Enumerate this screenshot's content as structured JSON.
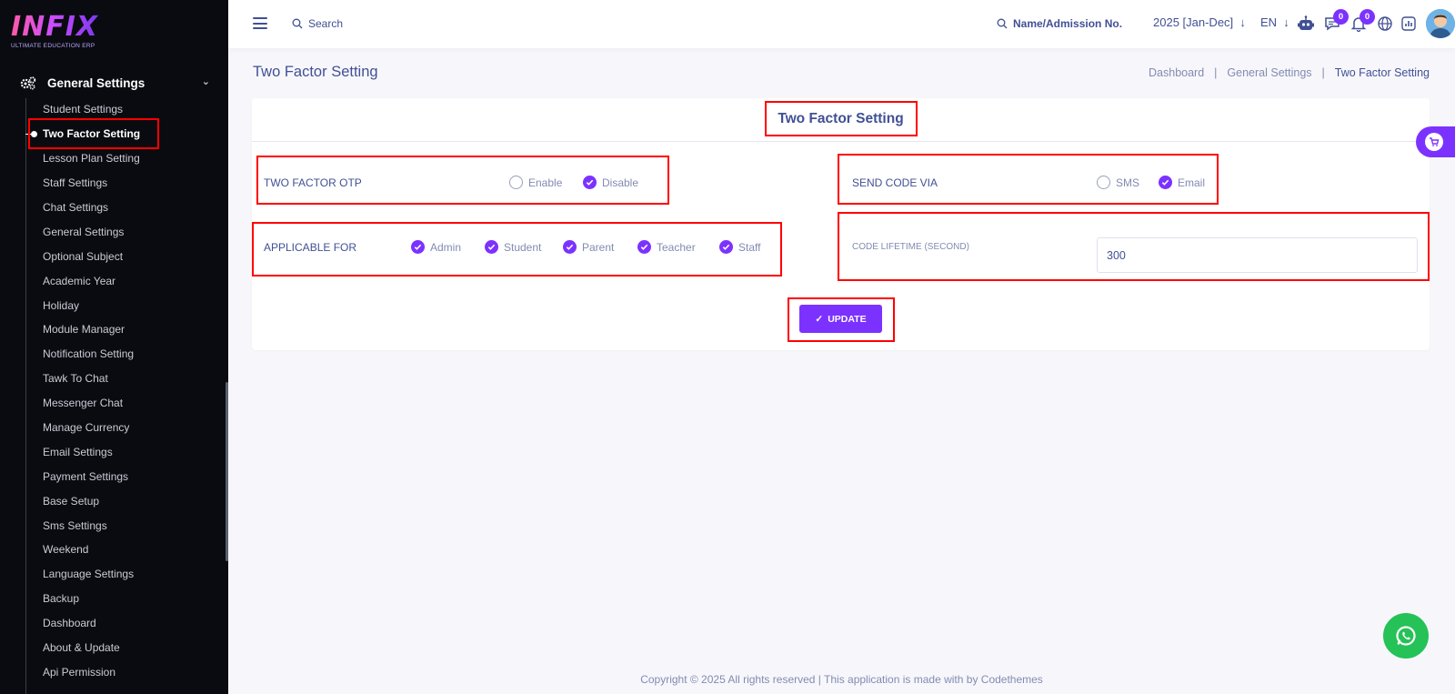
{
  "brand": {
    "logo": "INFIX",
    "tagline": "ULTIMATE EDUCATION ERP"
  },
  "sidebar": {
    "section": "General Settings",
    "items": [
      "Student Settings",
      "Two Factor Setting",
      "Lesson Plan Setting",
      "Staff Settings",
      "Chat Settings",
      "General Settings",
      "Optional Subject",
      "Academic Year",
      "Holiday",
      "Module Manager",
      "Notification Setting",
      "Tawk To Chat",
      "Messenger Chat",
      "Manage Currency",
      "Email Settings",
      "Payment Settings",
      "Base Setup",
      "Sms Settings",
      "Weekend",
      "Language Settings",
      "Backup",
      "Dashboard",
      "About & Update",
      "Api Permission"
    ],
    "active_index": 1
  },
  "header": {
    "search_label": "Search",
    "search_student_label": "Name/Admission No.",
    "academic_year": "2025 [Jan-Dec]",
    "language": "EN",
    "chat_badge": "0",
    "notification_badge": "0"
  },
  "page": {
    "title": "Two Factor Setting",
    "breadcrumb": [
      "Dashboard",
      "General Settings",
      "Two Factor Setting"
    ],
    "breadcrumb_separator": "|"
  },
  "form": {
    "title": "Two Factor Setting",
    "otp": {
      "label": "TWO FACTOR OTP",
      "options": [
        {
          "label": "Enable",
          "checked": false
        },
        {
          "label": "Disable",
          "checked": true
        }
      ]
    },
    "send_via": {
      "label": "SEND CODE VIA",
      "options": [
        {
          "label": "SMS",
          "checked": false
        },
        {
          "label": "Email",
          "checked": true
        }
      ]
    },
    "applicable": {
      "label": "APPLICABLE FOR",
      "options": [
        {
          "label": "Admin",
          "checked": true
        },
        {
          "label": "Student",
          "checked": true
        },
        {
          "label": "Parent",
          "checked": true
        },
        {
          "label": "Teacher",
          "checked": true
        },
        {
          "label": "Staff",
          "checked": true
        }
      ]
    },
    "lifetime": {
      "label": "CODE LIFETIME (SECOND)",
      "value": "300"
    },
    "update_label": "UPDATE"
  },
  "footer": {
    "text": "Copyright © 2025 All rights reserved | This application is made with by Codethemes"
  },
  "colors": {
    "accent": "#7c32ff",
    "text": "#415094",
    "muted": "#828bb2",
    "sidebar_bg": "#0a0b10",
    "highlight": "#ff0000",
    "whatsapp": "#25c257"
  }
}
